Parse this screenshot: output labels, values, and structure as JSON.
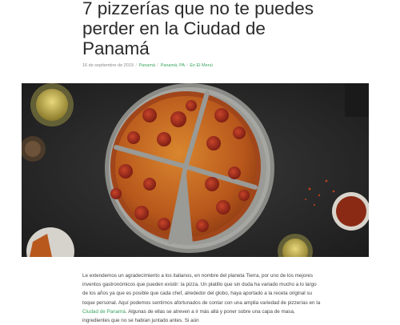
{
  "article": {
    "title": "7 pizzerías que no te puedes perder en la Ciudad de Panamá",
    "date": "16 de septiembre de 2019",
    "categories": [
      "Panamá",
      "Panamá, PA",
      "En El Menú"
    ],
    "image_description": "",
    "body_before_link_1": "Le extendemos un agradecimiento a los italianos, en nombre del planeta Tierra, por uno de los mejores inventos gastronómicos que pueden existir: la pizza. Un platillo que sin duda ha variado mucho a lo largo de los años ya que es posible que cada chef, alrededor del globo, haya aportado a la receta original su toque personal. Aquí podemos sentirnos afortunados de contar con una amplia variedad de pizzerías en la ",
    "body_link_1": "Ciudad de Panamá",
    "body_after_link_1": ". Algunas de ellas se atreven a ir más allá y poner sobre una capa de masa, ingredientes que no se habían juntado antes. Si aún"
  },
  "colors": {
    "link": "#3aa55c",
    "title": "#2b2b2b",
    "meta": "#8a8a8a"
  }
}
